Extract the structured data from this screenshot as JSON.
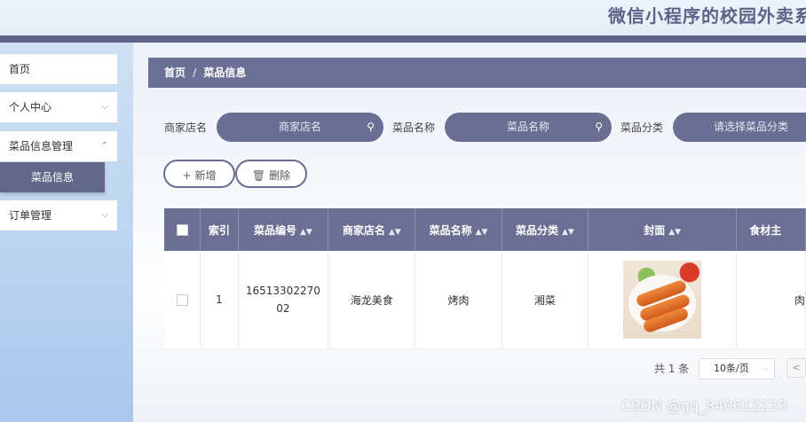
{
  "header": {
    "title": "微信小程序的校园外卖系"
  },
  "sidebar": {
    "items": [
      {
        "label": "首页"
      },
      {
        "label": "个人中心",
        "chevron": "chevron-down-icon"
      },
      {
        "label": "菜品信息管理",
        "chevron": "chevron-up-icon"
      },
      {
        "label": "订单管理",
        "chevron": "chevron-down-icon"
      }
    ],
    "subitem": {
      "label": "菜品信息"
    }
  },
  "breadcrumb": {
    "home": "首页",
    "separator": "/",
    "current": "菜品信息"
  },
  "search": {
    "fields": [
      {
        "label": "商家店名",
        "placeholder": "商家店名"
      },
      {
        "label": "菜品名称",
        "placeholder": "菜品名称"
      },
      {
        "label": "菜品分类",
        "placeholder": "请选择菜品分类"
      }
    ]
  },
  "actions": {
    "add": "新增",
    "delete": "删除"
  },
  "table": {
    "headers": [
      "索引",
      "菜品编号",
      "商家店名",
      "菜品名称",
      "菜品分类",
      "封面",
      "食材主"
    ],
    "rows": [
      {
        "index": "1",
        "code_line1": "16513302270",
        "code_line2": "02",
        "shop": "海龙美食",
        "dish": "烤肉",
        "category": "湘菜",
        "ingredient": "肉"
      }
    ]
  },
  "pagination": {
    "total": "共 1 条",
    "page_size": "10条/页"
  },
  "watermark": "CSDN @qq_840612233",
  "colors": {
    "primary": "#6a6f93",
    "sidebar": "#b9d3ef"
  }
}
